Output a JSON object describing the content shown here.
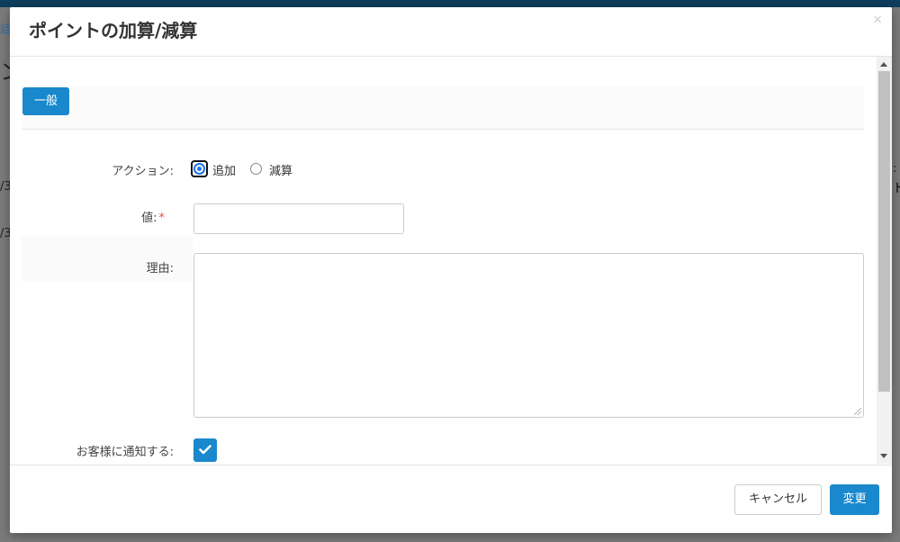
{
  "modal": {
    "title": "ポイントの加算/減算",
    "close_glyph": "×"
  },
  "tabs": [
    {
      "label": "一般"
    }
  ],
  "form": {
    "action": {
      "label": "アクション:",
      "options": [
        {
          "label": "追加",
          "checked": true
        },
        {
          "label": "減算",
          "checked": false
        }
      ]
    },
    "value": {
      "label": "値:",
      "required_mark": "*",
      "value": ""
    },
    "reason": {
      "label": "理由:",
      "value": ""
    },
    "notify": {
      "label": "お客様に通知する:",
      "checked": true
    }
  },
  "footer": {
    "cancel_label": "キャンセル",
    "submit_label": "変更"
  },
  "background": {
    "fragments": [
      "話",
      "ン",
      "/3",
      "/3",
      ": ",
      "ト"
    ]
  },
  "colors": {
    "primary": "#1a88cc",
    "required": "#e74c3c",
    "overlay": "#7b7b7b",
    "topbar": "#0d3e5c"
  },
  "icons": {
    "close": "close-icon",
    "checkbox": "check-icon"
  }
}
